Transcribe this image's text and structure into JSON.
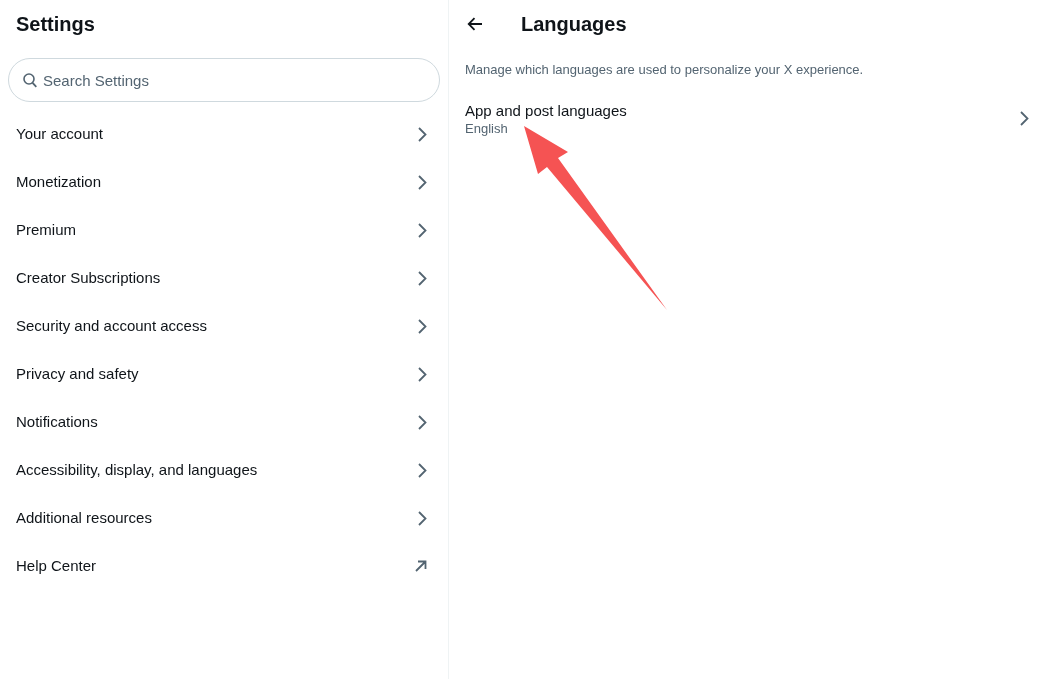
{
  "sidebar": {
    "title": "Settings",
    "search": {
      "placeholder": "Search Settings"
    },
    "items": [
      {
        "label": "Your account",
        "kind": "chevron"
      },
      {
        "label": "Monetization",
        "kind": "chevron"
      },
      {
        "label": "Premium",
        "kind": "chevron"
      },
      {
        "label": "Creator Subscriptions",
        "kind": "chevron"
      },
      {
        "label": "Security and account access",
        "kind": "chevron"
      },
      {
        "label": "Privacy and safety",
        "kind": "chevron"
      },
      {
        "label": "Notifications",
        "kind": "chevron"
      },
      {
        "label": "Accessibility, display, and languages",
        "kind": "chevron"
      },
      {
        "label": "Additional resources",
        "kind": "chevron"
      },
      {
        "label": "Help Center",
        "kind": "external"
      }
    ]
  },
  "detail": {
    "title": "Languages",
    "description": "Manage which languages are used to personalize your X experience.",
    "items": [
      {
        "label": "App and post languages",
        "value": "English"
      }
    ]
  }
}
